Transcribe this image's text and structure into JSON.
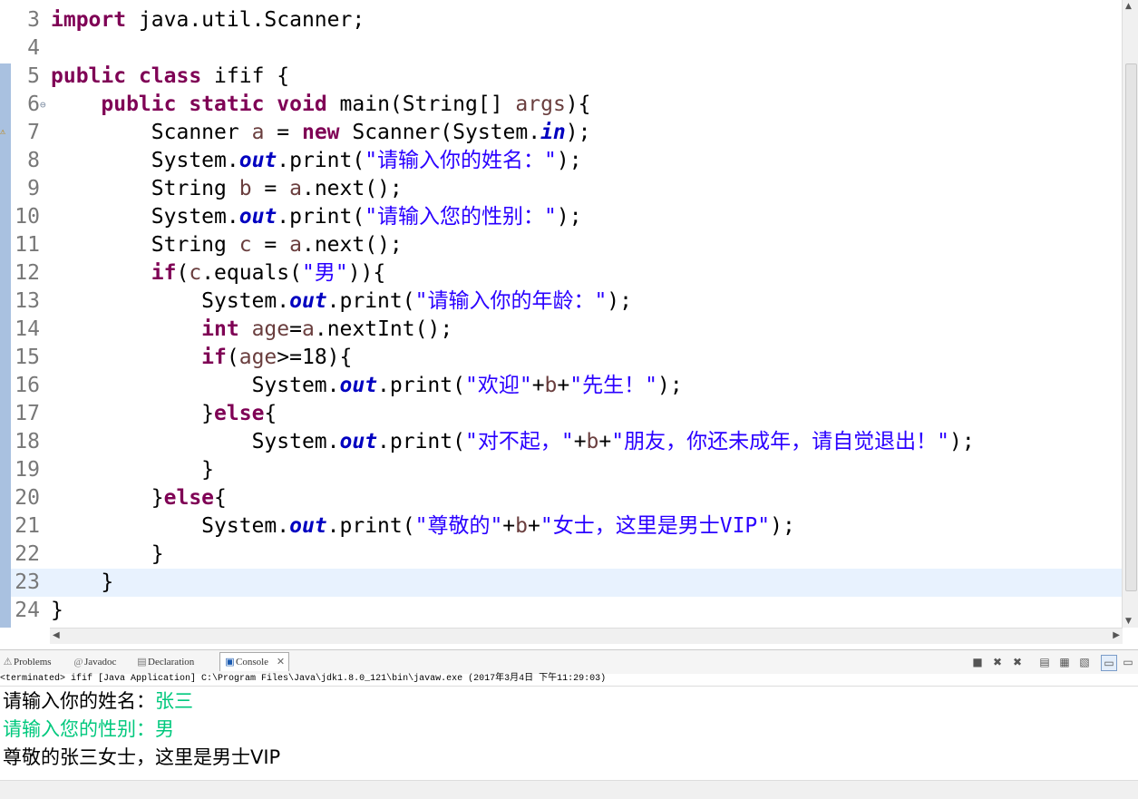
{
  "editor": {
    "lines": [
      {
        "n": "3",
        "indent": 0,
        "tokens": [
          {
            "t": "import",
            "c": "kw"
          },
          {
            "t": " java.util.Scanner;",
            "c": ""
          }
        ]
      },
      {
        "n": "4",
        "indent": 0,
        "tokens": []
      },
      {
        "n": "5",
        "indent": 0,
        "tokens": [
          {
            "t": "public",
            "c": "kw"
          },
          {
            "t": " ",
            "c": ""
          },
          {
            "t": "class",
            "c": "kw"
          },
          {
            "t": " ifif {",
            "c": ""
          }
        ]
      },
      {
        "n": "6",
        "indent": 1,
        "fold": true,
        "tokens": [
          {
            "t": "public",
            "c": "kw"
          },
          {
            "t": " ",
            "c": ""
          },
          {
            "t": "static",
            "c": "kw"
          },
          {
            "t": " ",
            "c": ""
          },
          {
            "t": "void",
            "c": "kw"
          },
          {
            "t": " main(String[] ",
            "c": ""
          },
          {
            "t": "args",
            "c": "vr"
          },
          {
            "t": "){",
            "c": ""
          }
        ]
      },
      {
        "n": "7",
        "indent": 2,
        "warning": true,
        "tokens": [
          {
            "t": "Scanner ",
            "c": ""
          },
          {
            "t": "a",
            "c": "vr"
          },
          {
            "t": " = ",
            "c": ""
          },
          {
            "t": "new",
            "c": "kw"
          },
          {
            "t": " Scanner(System.",
            "c": ""
          },
          {
            "t": "in",
            "c": "fd"
          },
          {
            "t": ");",
            "c": ""
          }
        ]
      },
      {
        "n": "8",
        "indent": 2,
        "tokens": [
          {
            "t": "System.",
            "c": ""
          },
          {
            "t": "out",
            "c": "fd"
          },
          {
            "t": ".print(",
            "c": ""
          },
          {
            "t": "\"请输入你的姓名：\"",
            "c": "st"
          },
          {
            "t": ");",
            "c": ""
          }
        ]
      },
      {
        "n": "9",
        "indent": 2,
        "tokens": [
          {
            "t": "String ",
            "c": ""
          },
          {
            "t": "b",
            "c": "vr"
          },
          {
            "t": " = ",
            "c": ""
          },
          {
            "t": "a",
            "c": "vr"
          },
          {
            "t": ".next();",
            "c": ""
          }
        ]
      },
      {
        "n": "10",
        "indent": 2,
        "tokens": [
          {
            "t": "System.",
            "c": ""
          },
          {
            "t": "out",
            "c": "fd"
          },
          {
            "t": ".print(",
            "c": ""
          },
          {
            "t": "\"请输入您的性别：\"",
            "c": "st"
          },
          {
            "t": ");",
            "c": ""
          }
        ]
      },
      {
        "n": "11",
        "indent": 2,
        "tokens": [
          {
            "t": "String ",
            "c": ""
          },
          {
            "t": "c",
            "c": "vr"
          },
          {
            "t": " = ",
            "c": ""
          },
          {
            "t": "a",
            "c": "vr"
          },
          {
            "t": ".next();",
            "c": ""
          }
        ]
      },
      {
        "n": "12",
        "indent": 2,
        "tokens": [
          {
            "t": "if",
            "c": "kw"
          },
          {
            "t": "(",
            "c": ""
          },
          {
            "t": "c",
            "c": "vr"
          },
          {
            "t": ".equals(",
            "c": ""
          },
          {
            "t": "\"男\"",
            "c": "st"
          },
          {
            "t": ")){",
            "c": ""
          }
        ]
      },
      {
        "n": "13",
        "indent": 3,
        "tokens": [
          {
            "t": "System.",
            "c": ""
          },
          {
            "t": "out",
            "c": "fd"
          },
          {
            "t": ".print(",
            "c": ""
          },
          {
            "t": "\"请输入你的年龄：\"",
            "c": "st"
          },
          {
            "t": ");",
            "c": ""
          }
        ]
      },
      {
        "n": "14",
        "indent": 3,
        "tokens": [
          {
            "t": "int",
            "c": "kw"
          },
          {
            "t": " ",
            "c": ""
          },
          {
            "t": "age",
            "c": "vr"
          },
          {
            "t": "=",
            "c": ""
          },
          {
            "t": "a",
            "c": "vr"
          },
          {
            "t": ".nextInt();",
            "c": ""
          }
        ]
      },
      {
        "n": "15",
        "indent": 3,
        "tokens": [
          {
            "t": "if",
            "c": "kw"
          },
          {
            "t": "(",
            "c": ""
          },
          {
            "t": "age",
            "c": "vr"
          },
          {
            "t": ">=18){",
            "c": ""
          }
        ]
      },
      {
        "n": "16",
        "indent": 4,
        "tokens": [
          {
            "t": "System.",
            "c": ""
          },
          {
            "t": "out",
            "c": "fd"
          },
          {
            "t": ".print(",
            "c": ""
          },
          {
            "t": "\"欢迎\"",
            "c": "st"
          },
          {
            "t": "+",
            "c": ""
          },
          {
            "t": "b",
            "c": "vr"
          },
          {
            "t": "+",
            "c": ""
          },
          {
            "t": "\"先生！\"",
            "c": "st"
          },
          {
            "t": ");",
            "c": ""
          }
        ]
      },
      {
        "n": "17",
        "indent": 3,
        "tokens": [
          {
            "t": "}",
            "c": ""
          },
          {
            "t": "else",
            "c": "kw"
          },
          {
            "t": "{",
            "c": ""
          }
        ]
      },
      {
        "n": "18",
        "indent": 4,
        "tokens": [
          {
            "t": "System.",
            "c": ""
          },
          {
            "t": "out",
            "c": "fd"
          },
          {
            "t": ".print(",
            "c": ""
          },
          {
            "t": "\"对不起，\"",
            "c": "st"
          },
          {
            "t": "+",
            "c": ""
          },
          {
            "t": "b",
            "c": "vr"
          },
          {
            "t": "+",
            "c": ""
          },
          {
            "t": "\"朋友，你还未成年，请自觉退出！\"",
            "c": "st"
          },
          {
            "t": ");",
            "c": ""
          }
        ]
      },
      {
        "n": "19",
        "indent": 3,
        "tokens": [
          {
            "t": "}",
            "c": ""
          }
        ]
      },
      {
        "n": "20",
        "indent": 2,
        "tokens": [
          {
            "t": "}",
            "c": ""
          },
          {
            "t": "else",
            "c": "kw"
          },
          {
            "t": "{",
            "c": ""
          }
        ]
      },
      {
        "n": "21",
        "indent": 3,
        "tokens": [
          {
            "t": "System.",
            "c": ""
          },
          {
            "t": "out",
            "c": "fd"
          },
          {
            "t": ".print(",
            "c": ""
          },
          {
            "t": "\"尊敬的\"",
            "c": "st"
          },
          {
            "t": "+",
            "c": ""
          },
          {
            "t": "b",
            "c": "vr"
          },
          {
            "t": "+",
            "c": ""
          },
          {
            "t": "\"女士，这里是男士VIP\"",
            "c": "st"
          },
          {
            "t": ");",
            "c": ""
          }
        ]
      },
      {
        "n": "22",
        "indent": 2,
        "tokens": [
          {
            "t": "}",
            "c": ""
          }
        ]
      },
      {
        "n": "23",
        "indent": 1,
        "current": true,
        "tokens": [
          {
            "t": "}",
            "c": ""
          }
        ]
      },
      {
        "n": "24",
        "indent": 0,
        "tokens": [
          {
            "t": "}",
            "c": ""
          }
        ]
      }
    ]
  },
  "views": {
    "problems": "Problems",
    "javadoc": "Javadoc",
    "declaration": "Declaration",
    "console": "Console"
  },
  "console": {
    "status": "<terminated> ifif [Java Application] C:\\Program Files\\Java\\jdk1.8.0_121\\bin\\javaw.exe (2017年3月4日 下午11:29:03)",
    "rows": [
      [
        {
          "t": "请输入你的姓名：",
          "k": "out"
        },
        {
          "t": "张三",
          "k": "in"
        }
      ],
      [
        {
          "t": "请输入您的性别：男",
          "k": "in"
        }
      ],
      [
        {
          "t": "尊敬的张三女士，这里是男士VIP",
          "k": "out"
        }
      ]
    ]
  }
}
